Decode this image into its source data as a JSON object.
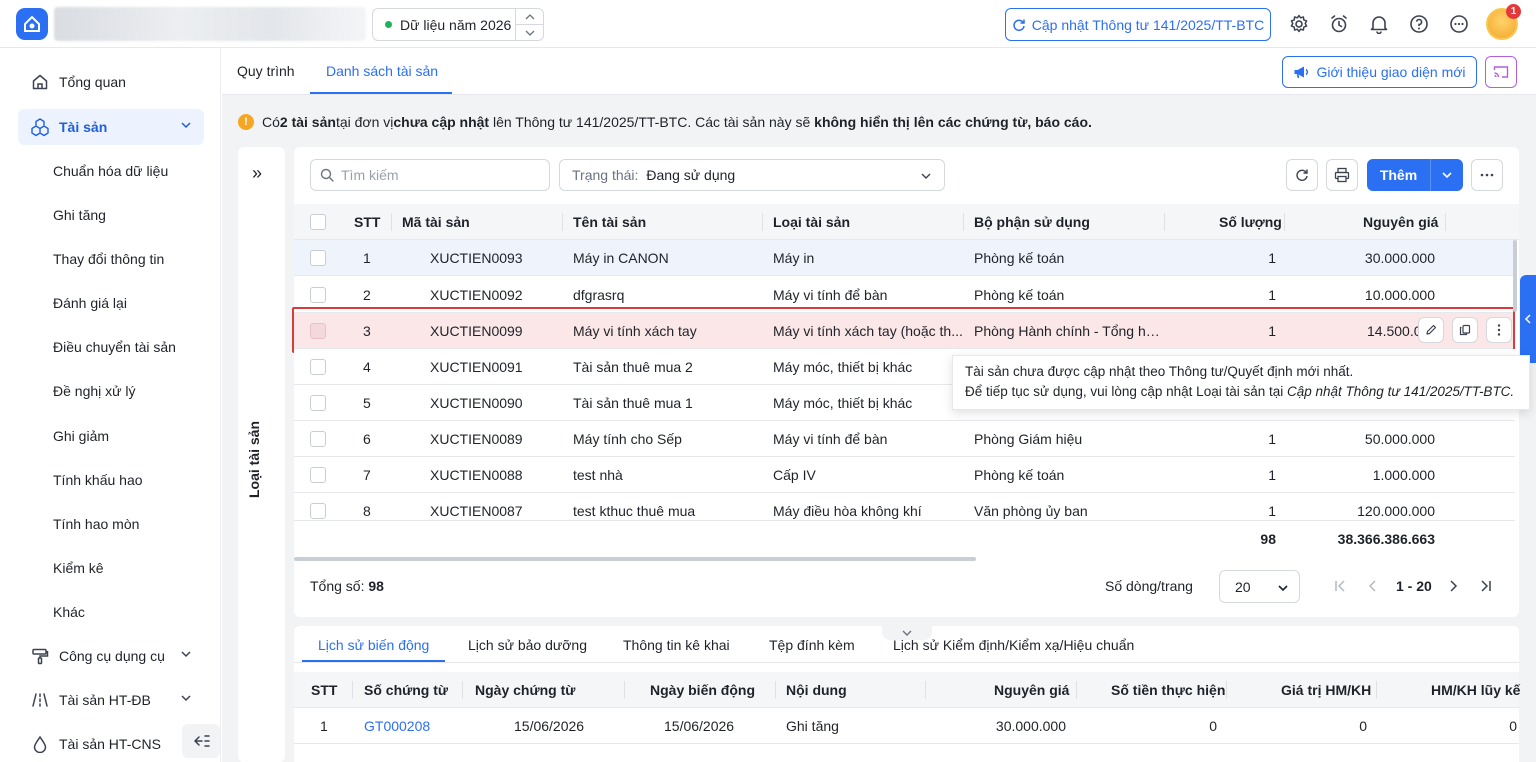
{
  "header": {
    "year_label": "Dữ liệu năm 2026",
    "update_button": "Cập nhật Thông tư 141/2025/TT-BTC",
    "notification_count": "1"
  },
  "sidebar": {
    "items": [
      {
        "label": "Tổng quan",
        "icon": "home-icon"
      },
      {
        "label": "Tài sản",
        "icon": "assets-icon"
      },
      {
        "label": "Công cụ dụng cụ",
        "icon": "tools-icon"
      },
      {
        "label": "Tài sản HT-ĐB",
        "icon": "road-icon"
      },
      {
        "label": "Tài sản HT-CNS",
        "icon": "water-icon"
      }
    ],
    "sub_items": [
      "Chuẩn hóa dữ liệu",
      "Ghi tăng",
      "Thay đổi thông tin",
      "Đánh giá lại",
      "Điều chuyển tài sản",
      "Đề nghị xử lý",
      "Ghi giảm",
      "Tính khấu hao",
      "Tính hao mòn",
      "Kiểm kê",
      "Khác"
    ]
  },
  "tabs": [
    "Quy trình",
    "Danh sách tài sản"
  ],
  "intro_button": "Giới thiệu giao diện mới",
  "notice": {
    "p1": "Có ",
    "b1": "2 tài sản",
    "p2": " tại đơn vị ",
    "b2": "chưa cập nhật",
    "p3": " lên Thông tư 141/2025/TT-BTC. Các tài sản này sẽ ",
    "b3": "không hiển thị lên các chứng từ, báo cáo."
  },
  "category_panel": {
    "label": "Loại tài sản",
    "expand": "»"
  },
  "toolbar": {
    "search_placeholder": "Tìm kiếm",
    "status_label": "Trạng thái:",
    "status_value": "Đang sử dụng",
    "add_label": "Thêm"
  },
  "grid": {
    "columns": [
      "STT",
      "Mã tài sản",
      "Tên tài sản",
      "Loại tài sản",
      "Bộ phận sử dụng",
      "Số lượng",
      "Nguyên giá"
    ],
    "rows": [
      {
        "stt": "1",
        "code": "XUCTIEN0093",
        "name": "Máy in CANON",
        "type": "Máy in",
        "dept": "Phòng kế toán",
        "qty": "1",
        "price": "30.000.000"
      },
      {
        "stt": "2",
        "code": "XUCTIEN0092",
        "name": "dfgrasrq",
        "type": "Máy vi tính để bàn",
        "dept": "Phòng kế toán",
        "qty": "1",
        "price": "10.000.000"
      },
      {
        "stt": "3",
        "code": "XUCTIEN0099",
        "name": "Máy vi tính xách tay",
        "type": "Máy vi tính xách tay (hoặc th...",
        "dept": "Phòng Hành chính - Tổng hợ...",
        "qty": "1",
        "price": "14.500.0"
      },
      {
        "stt": "4",
        "code": "XUCTIEN0091",
        "name": "Tài sản thuê mua 2",
        "type": "Máy móc, thiết bị khác",
        "dept": "",
        "qty": "",
        "price": ""
      },
      {
        "stt": "5",
        "code": "XUCTIEN0090",
        "name": "Tài sản thuê mua 1",
        "type": "Máy móc, thiết bị khác",
        "dept": "",
        "qty": "",
        "price": ""
      },
      {
        "stt": "6",
        "code": "XUCTIEN0089",
        "name": "Máy tính cho Sếp",
        "type": "Máy vi tính để bàn",
        "dept": "Phòng Giám hiệu",
        "qty": "1",
        "price": "50.000.000"
      },
      {
        "stt": "7",
        "code": "XUCTIEN0088",
        "name": "test nhà",
        "type": "Cấp IV",
        "dept": "Phòng kế toán",
        "qty": "1",
        "price": "1.000.000"
      },
      {
        "stt": "8",
        "code": "XUCTIEN0087",
        "name": "test kthuc thuê mua",
        "type": "Máy điều hòa không khí",
        "dept": "Văn phòng ủy ban",
        "qty": "1",
        "price": "120.000.000"
      }
    ],
    "total_qty": "98",
    "total_price": "38.366.386.663"
  },
  "tooltip": {
    "line1": "Tài sản chưa được cập nhật theo Thông tư/Quyết định mới nhất.",
    "line2": "Để tiếp tục sử dụng, vui lòng cập nhật Loại tài sản tại ",
    "line2_link": "Cập nhật Thông tư 141/2025/TT-BTC."
  },
  "pager": {
    "total_label": "Tổng số: ",
    "total_value": "98",
    "rows_label": "Số dòng/trang",
    "rows_value": "20",
    "range": "1 - 20"
  },
  "bottom": {
    "tabs": [
      "Lịch sử biến động",
      "Lịch sử bảo dưỡng",
      "Thông tin kê khai",
      "Tệp đính kèm",
      "Lịch sử Kiểm định/Kiểm xạ/Hiệu chuẩn"
    ],
    "columns": [
      "STT",
      "Số chứng từ",
      "Ngày chứng từ",
      "Ngày biến động",
      "Nội dung",
      "Nguyên giá",
      "Số tiền thực hiện",
      "Giá trị HM/KH",
      "HM/KH lũy kế"
    ],
    "row": {
      "stt": "1",
      "doc": "GT000208",
      "doc_date": "15/06/2026",
      "change_date": "15/06/2026",
      "content": "Ghi tăng",
      "price": "30.000.000",
      "amount": "0",
      "hm": "0",
      "hm_cum": "0"
    }
  },
  "colors": {
    "accent": "#2b6ff3",
    "error": "#d93b3b",
    "error_bg": "#fbe7e8",
    "success": "#1fb25a",
    "warning": "#f5a623"
  }
}
